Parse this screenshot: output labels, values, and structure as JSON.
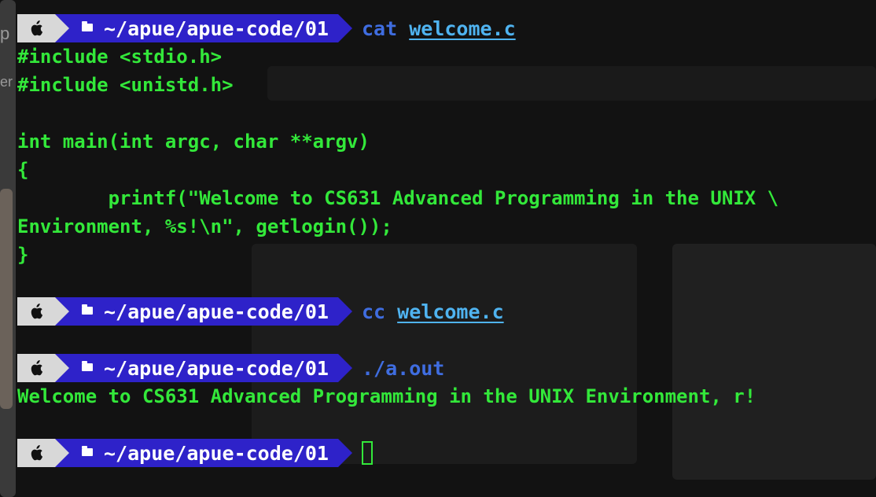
{
  "terminal": {
    "prompt_path": "~/apue/apue-code/01",
    "entries": [
      {
        "command": "cat",
        "argument": "welcome.c"
      },
      {
        "command": "cc",
        "argument": "welcome.c"
      },
      {
        "command": "./a.out",
        "argument": ""
      },
      {
        "command": "",
        "argument": ""
      }
    ],
    "code_lines": [
      "#include <stdio.h>",
      "#include <unistd.h>",
      "",
      "int main(int argc, char **argv)",
      "{",
      "        printf(\"Welcome to CS631 Advanced Programming in the UNIX \\",
      "Environment, %s!\\n\", getlogin());",
      "}"
    ],
    "program_output": "Welcome to CS631 Advanced Programming in the UNIX Environment, r!"
  },
  "background_fragments": [
    "p",
    "er"
  ],
  "colors": {
    "terminal_bg": "#121212",
    "code_text": "#33e83a",
    "command_text": "#3f6de0",
    "argument_text": "#4fb3f0",
    "os_segment": "#d8d8d8",
    "path_segment": "#2e22c9"
  }
}
